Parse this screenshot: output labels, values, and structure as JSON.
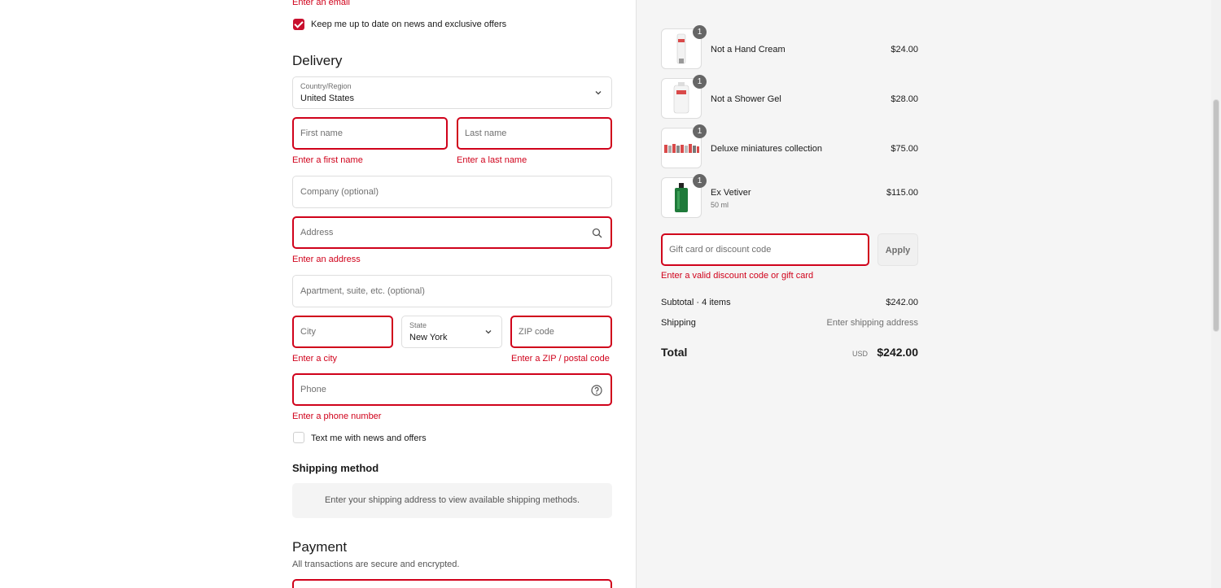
{
  "contact": {
    "email_error": "Enter an email",
    "newsletter_label": "Keep me up to date on news and exclusive offers",
    "newsletter_checked": true
  },
  "delivery": {
    "title": "Delivery",
    "country": {
      "label": "Country/Region",
      "value": "United States"
    },
    "first_name": {
      "placeholder": "First name",
      "error": "Enter a first name"
    },
    "last_name": {
      "placeholder": "Last name",
      "error": "Enter a last name"
    },
    "company": {
      "placeholder": "Company (optional)"
    },
    "address": {
      "placeholder": "Address",
      "error": "Enter an address"
    },
    "apartment": {
      "placeholder": "Apartment, suite, etc. (optional)"
    },
    "city": {
      "placeholder": "City",
      "error": "Enter a city"
    },
    "state": {
      "label": "State",
      "value": "New York"
    },
    "zip": {
      "placeholder": "ZIP code",
      "error": "Enter a ZIP / postal code"
    },
    "phone": {
      "placeholder": "Phone",
      "error": "Enter a phone number"
    },
    "sms_label": "Text me with news and offers",
    "sms_checked": false
  },
  "shipping_method": {
    "title": "Shipping method",
    "message": "Enter your shipping address to view available shipping methods."
  },
  "payment": {
    "title": "Payment",
    "subtitle": "All transactions are secure and encrypted."
  },
  "cart": {
    "items": [
      {
        "name": "Not a Hand Cream",
        "variant": "",
        "price": "$24.00",
        "quantity": "1",
        "thumb_color": "#eeeeee"
      },
      {
        "name": "Not a Shower Gel",
        "variant": "",
        "price": "$28.00",
        "quantity": "1",
        "thumb_color": "#eeeeee"
      },
      {
        "name": "Deluxe miniatures collection",
        "variant": "",
        "price": "$75.00",
        "quantity": "1",
        "thumb_color": "#d94a4a"
      },
      {
        "name": "Ex Vetiver",
        "variant": "50 ml",
        "price": "$115.00",
        "quantity": "1",
        "thumb_color": "#1f7a3a"
      }
    ],
    "discount": {
      "placeholder": "Gift card or discount code",
      "apply_label": "Apply",
      "error": "Enter a valid discount code or gift card"
    },
    "subtotal_label": "Subtotal · 4 items",
    "subtotal_value": "$242.00",
    "shipping_label": "Shipping",
    "shipping_value": "Enter shipping address",
    "total_label": "Total",
    "total_currency": "USD",
    "total_value": "$242.00"
  },
  "colors": {
    "accent": "#c8102e",
    "error": "#d0021b",
    "sidebar_bg": "#f5f5f5"
  }
}
